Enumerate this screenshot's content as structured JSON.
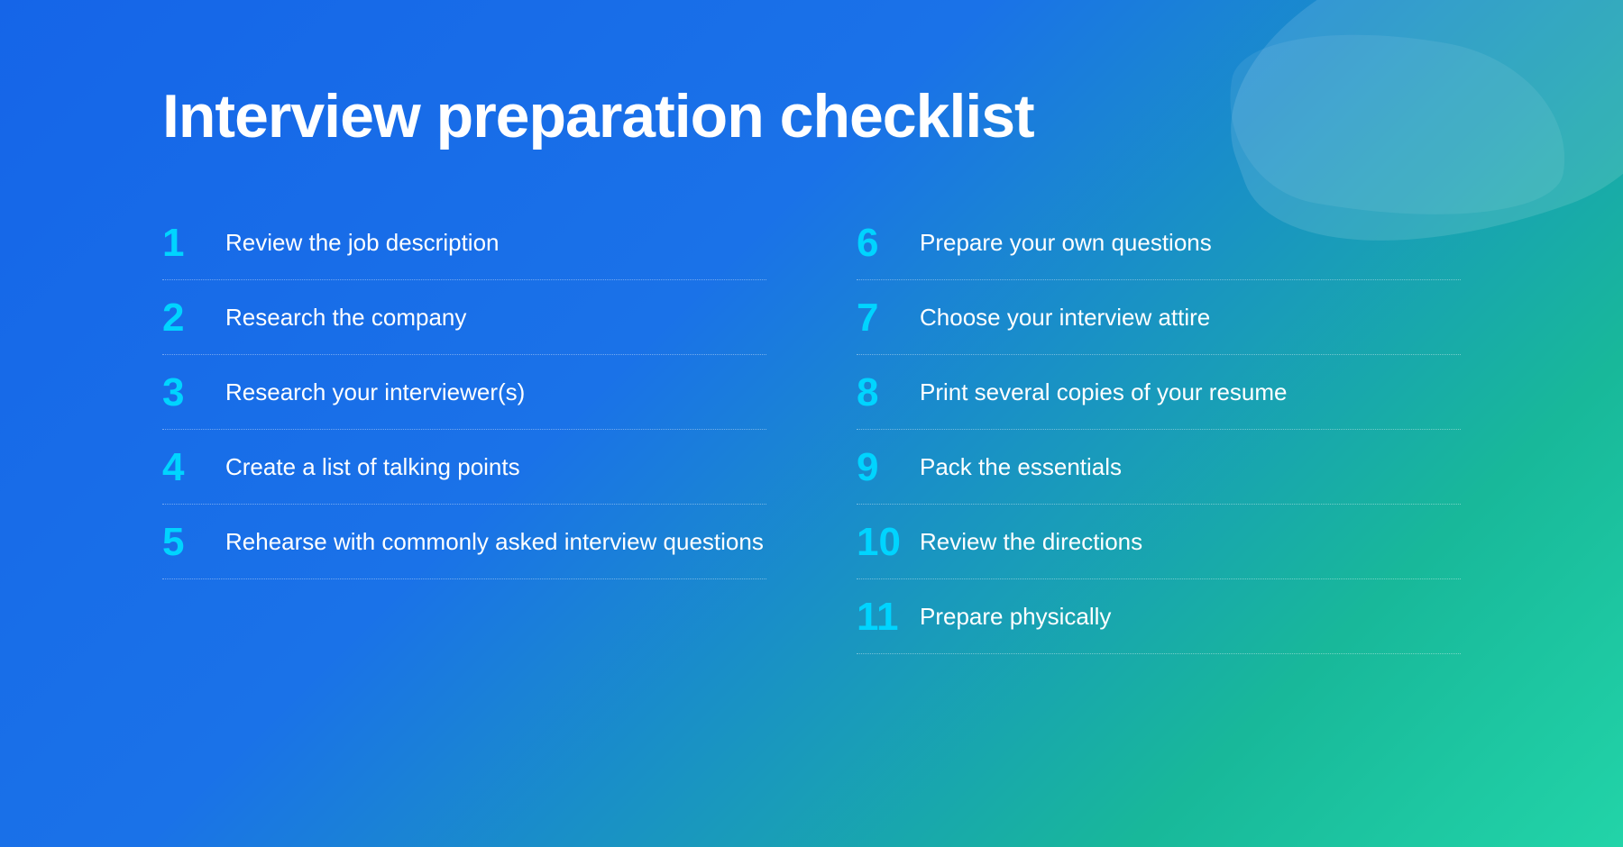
{
  "page": {
    "title": "Interview preparation checklist",
    "background_gradient": "linear-gradient(135deg, #1565e8, #18b89a)",
    "accent_color": "#00d4ff",
    "text_color": "#ffffff"
  },
  "checklist": {
    "left_column": [
      {
        "number": "1",
        "text": "Review the job description"
      },
      {
        "number": "2",
        "text": "Research the company"
      },
      {
        "number": "3",
        "text": "Research your interviewer(s)"
      },
      {
        "number": "4",
        "text": "Create a list of talking points"
      },
      {
        "number": "5",
        "text": "Rehearse with commonly asked interview questions"
      }
    ],
    "right_column": [
      {
        "number": "6",
        "text": "Prepare your own questions"
      },
      {
        "number": "7",
        "text": "Choose your interview attire"
      },
      {
        "number": "8",
        "text": "Print several copies of your resume"
      },
      {
        "number": "9",
        "text": "Pack the essentials"
      },
      {
        "number": "10",
        "text": "Review the directions"
      },
      {
        "number": "11",
        "text": "Prepare physically"
      }
    ]
  }
}
